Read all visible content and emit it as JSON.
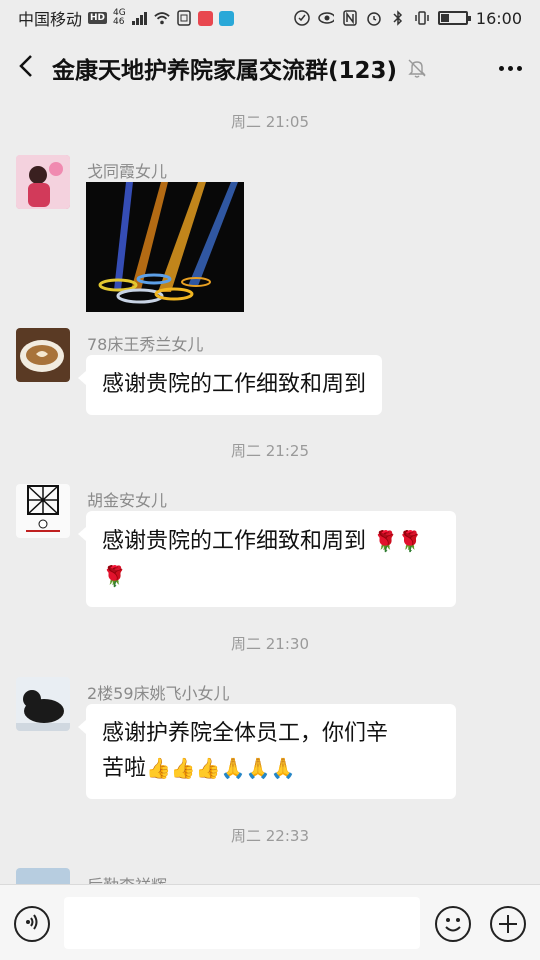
{
  "status_bar": {
    "carrier": "中国移动",
    "hd_badge": "HD",
    "network_top": "4G",
    "network_bottom": "46",
    "time": "16:00",
    "battery_level": 0.3
  },
  "header": {
    "title": "金康天地护养院家属交流群(123)"
  },
  "messages": [
    {
      "type": "timestamp",
      "text": "周二 21:05"
    },
    {
      "type": "image",
      "sender": "戈同霞女儿"
    },
    {
      "type": "text",
      "sender": "78床王秀兰女儿",
      "text": "感谢贵院的工作细致和周到"
    },
    {
      "type": "timestamp",
      "text": "周二 21:25"
    },
    {
      "type": "text",
      "sender": "胡金安女儿",
      "text": "感谢贵院的工作细致和周到",
      "emoji": "🌹🌹🌹"
    },
    {
      "type": "timestamp",
      "text": "周二 21:30"
    },
    {
      "type": "text",
      "sender": "2楼59床姚飞小女儿",
      "line1": "感谢护养院全体员工，你们辛",
      "line2": "苦啦",
      "emoji": "👍👍👍🙏🙏🙏"
    },
    {
      "type": "timestamp",
      "text": "周二 22:33"
    },
    {
      "type": "partial",
      "sender": "后勤李祥辉"
    }
  ],
  "icons": {
    "back": "chevron-left-icon",
    "mute": "bell-off-icon",
    "more": "more-dots-icon",
    "voice": "voice-icon",
    "emoji": "emoji-icon",
    "plus": "plus-icon"
  }
}
